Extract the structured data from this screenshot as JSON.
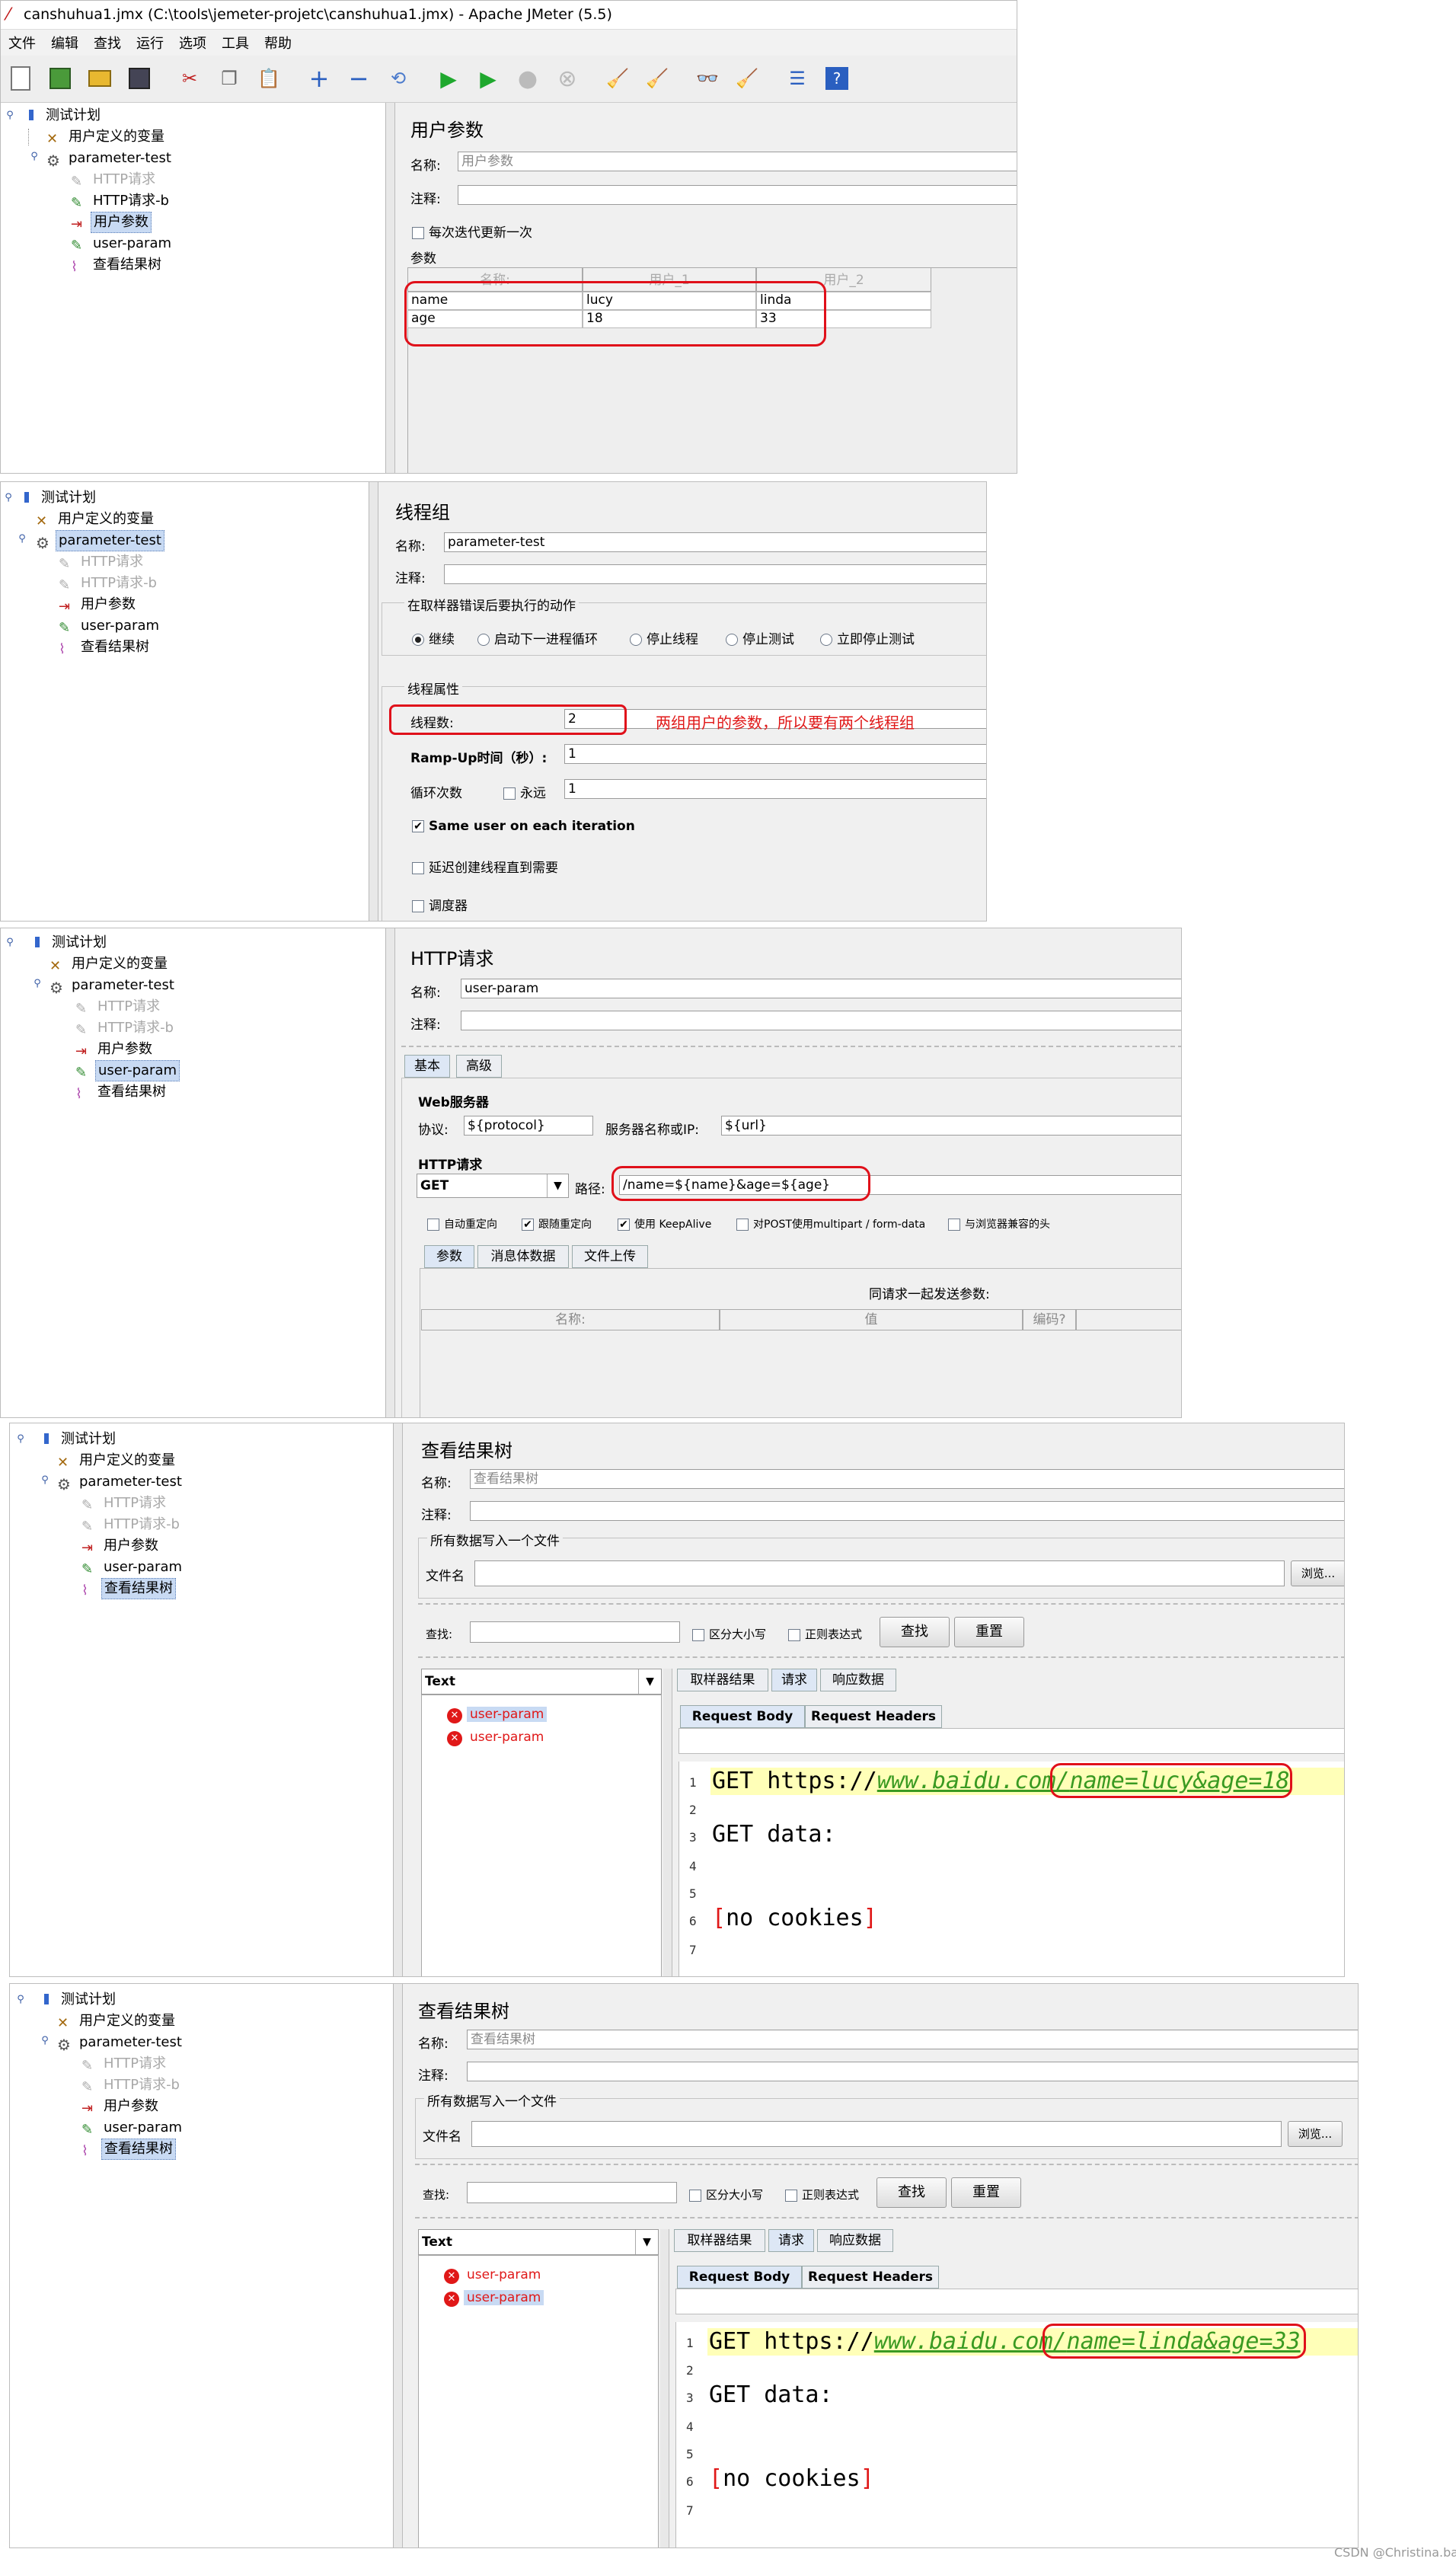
{
  "window": {
    "title": "canshuhua1.jmx (C:\\tools\\jemeter-projetc\\canshuhua1.jmx) - Apache JMeter (5.5)"
  },
  "menu": [
    "文件",
    "编辑",
    "查找",
    "运行",
    "选项",
    "工具",
    "帮助"
  ],
  "toolbar_icons": [
    "new-icon",
    "templates-icon",
    "open-icon",
    "save-icon",
    "cut-icon",
    "copy-icon",
    "paste-icon",
    "expand-icon",
    "collapse-icon",
    "toggle-icon",
    "start-icon",
    "start-no-pause-icon",
    "stop-icon",
    "shutdown-icon",
    "clear-icon",
    "clear-all-icon",
    "search-icon",
    "reset-search-icon",
    "function-helper-icon",
    "help-icon"
  ],
  "tree": {
    "plan": "测试计划",
    "vars": "用户定义的变量",
    "group": "parameter-test",
    "http1": "HTTP请求",
    "http2": "HTTP请求-b",
    "userparams": "用户参数",
    "userparam": "user-param",
    "results": "查看结果树"
  },
  "panel1": {
    "title": "用户参数",
    "name_label": "名称:",
    "name_value": "用户参数",
    "comment_label": "注释:",
    "per_iter": "每次迭代更新一次",
    "params_label": "参数",
    "headers": [
      "名称:",
      "用户_1",
      "用户_2"
    ],
    "rows": [
      [
        "name",
        "lucy",
        "linda"
      ],
      [
        "age",
        "18",
        "33"
      ]
    ]
  },
  "panel2": {
    "title": "线程组",
    "name_label": "名称:",
    "name_value": "parameter-test",
    "comment_label": "注释:",
    "error_group": "在取样器错误后要执行的动作",
    "actions": [
      "继续",
      "启动下一进程循环",
      "停止线程",
      "停止测试",
      "立即停止测试"
    ],
    "props_group": "线程属性",
    "threads_label": "线程数:",
    "threads_value": "2",
    "annotation": "两组用户的参数，所以要有两个线程组",
    "rampup_label": "Ramp-Up时间（秒）:",
    "rampup_value": "1",
    "loop_label": "循环次数",
    "forever": "永远",
    "loop_value": "1",
    "same_user": "Same user on each iteration",
    "delay": "延迟创建线程直到需要",
    "scheduler": "调度器"
  },
  "panel3": {
    "title": "HTTP请求",
    "name_label": "名称:",
    "name_value": "user-param",
    "comment_label": "注释:",
    "tabs": [
      "基本",
      "高级"
    ],
    "web_server": "Web服务器",
    "protocol_label": "协议:",
    "protocol_value": "${protocol}",
    "server_label": "服务器名称或IP:",
    "server_value": "${url}",
    "http_req": "HTTP请求",
    "method": "GET",
    "path_label": "路径:",
    "path_value": "/name=${name}&age=${age}",
    "opts": [
      "自动重定向",
      "跟随重定向",
      "使用 KeepAlive",
      "对POST使用multipart / form-data",
      "与浏览器兼容的头"
    ],
    "subtabs": [
      "参数",
      "消息体数据",
      "文件上传"
    ],
    "send_params": "同请求一起发送参数:",
    "cols": [
      "名称:",
      "值",
      "编码?"
    ]
  },
  "result": {
    "title": "查看结果树",
    "name_label": "名称:",
    "name_value": "查看结果树",
    "comment_label": "注释:",
    "write_group": "所有数据写入一个文件",
    "file_label": "文件名",
    "browse": "浏览...",
    "search_label": "查找:",
    "case": "区分大小写",
    "regex": "正则表达式",
    "find_btn": "查找",
    "reset_btn": "重置",
    "renderer": "Text",
    "samples": [
      "user-param",
      "user-param"
    ],
    "tabs": [
      "取样器结果",
      "请求",
      "响应数据"
    ],
    "subtabs": [
      "Request Body",
      "Request Headers"
    ],
    "line_nums": [
      "1",
      "2",
      "3",
      "4",
      "5",
      "6",
      "7"
    ],
    "get_prefix": "GET https://",
    "host": "www.baidu.com/",
    "get_data": "GET data:",
    "cookies_open": "[",
    "cookies_text": "no cookies",
    "cookies_close": "]"
  },
  "panel4": {
    "query": "name=lucy&age=18"
  },
  "panel5": {
    "query": "name=linda&age=33"
  },
  "watermark": "CSDN @Christina.bai"
}
